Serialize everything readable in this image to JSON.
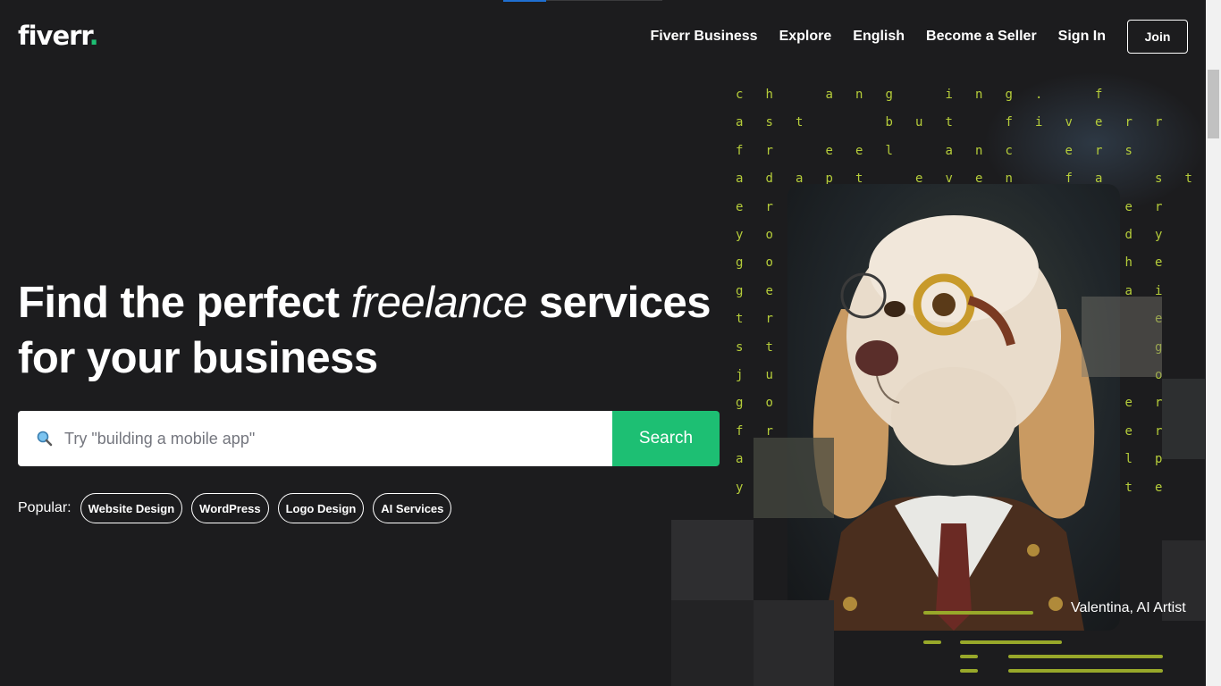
{
  "header": {
    "logo_text": "fiverr",
    "logo_dot": ".",
    "nav": [
      "Fiverr Business",
      "Explore",
      "English",
      "Become a Seller",
      "Sign In"
    ],
    "join_label": "Join"
  },
  "hero": {
    "title_part1": "Find the perfect ",
    "title_italic": "freelance",
    "title_part2": " services",
    "title_line2": "for your business",
    "search_placeholder": "Try \"building a mobile app\"",
    "search_button": "Search",
    "popular_label": "Popular:",
    "popular_tags": [
      "Website Design",
      "WordPress",
      "Logo Design",
      "AI Services"
    ]
  },
  "artwork": {
    "caption": "Valentina, AI Artist",
    "matrix_rows": [
      [
        "c",
        "h",
        "",
        "a",
        "n",
        "g",
        "",
        "i",
        "n",
        "g",
        ".",
        "",
        "f"
      ],
      [
        "a",
        "s",
        "t",
        "",
        "",
        "b",
        "u",
        "t",
        "",
        "f",
        "i",
        "v",
        "e",
        "r",
        "r"
      ],
      [
        "f",
        "r",
        "",
        "e",
        "e",
        "l",
        "",
        "a",
        "n",
        "c",
        "",
        "e",
        "r",
        "s"
      ],
      [
        "a",
        "d",
        "a",
        "p",
        "t",
        "",
        "e",
        "v",
        "e",
        "n",
        "",
        "f",
        "a",
        "",
        "s",
        "t"
      ],
      [
        "e",
        "r",
        "",
        "",
        "",
        "",
        "",
        "",
        "",
        "",
        "",
        "",
        "n",
        "e",
        "r"
      ],
      [
        "y",
        "o",
        "",
        "",
        "",
        "",
        "",
        "",
        "",
        "",
        "",
        "",
        "a",
        "d",
        "y"
      ],
      [
        "g",
        "o",
        "",
        "",
        "",
        "",
        "",
        "",
        "",
        "",
        "",
        "",
        "t",
        "h",
        "e"
      ],
      [
        "g",
        "e",
        "",
        "",
        "",
        "",
        "",
        "",
        "",
        "",
        "",
        "",
        "",
        "a",
        "i"
      ],
      [
        "t",
        "r",
        "",
        "",
        "",
        "",
        "",
        "",
        "",
        "",
        "",
        "",
        "",
        "",
        "e"
      ],
      [
        "s",
        "t",
        "",
        "",
        "",
        "",
        "",
        "",
        "",
        "",
        "",
        "",
        "",
        "",
        "g"
      ],
      [
        "j",
        "u",
        "",
        "",
        "",
        "",
        "",
        "",
        "",
        "",
        "",
        "",
        "",
        "",
        "o"
      ],
      [
        "g",
        "o",
        "",
        "",
        "",
        "",
        "",
        "",
        "",
        "",
        "",
        "",
        "",
        "e",
        "r"
      ],
      [
        "f",
        "r",
        "",
        "",
        "",
        "",
        "",
        "",
        "",
        "",
        "",
        "",
        "",
        "e",
        "r"
      ],
      [
        "a",
        "",
        "",
        "",
        "",
        "",
        "",
        "",
        "",
        "",
        "",
        "",
        "e",
        "l",
        "p"
      ],
      [
        "y",
        "",
        "",
        "",
        "",
        "",
        "",
        "",
        "",
        "",
        "",
        "",
        "a",
        "t",
        "e"
      ]
    ]
  },
  "colors": {
    "background": "#1c1c1e",
    "brand_green": "#1dbf73",
    "matrix_text": "#b5cc3a"
  }
}
